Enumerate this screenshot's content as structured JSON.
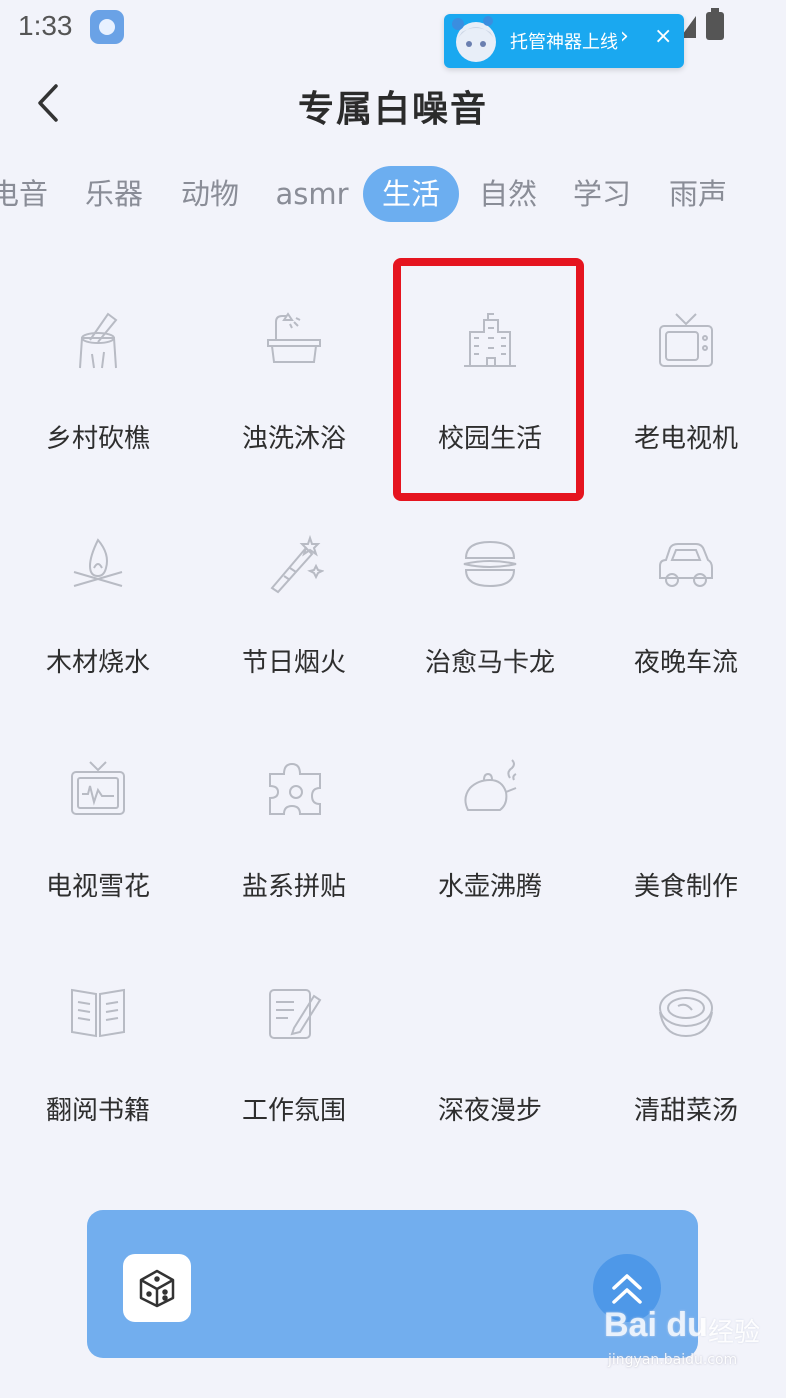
{
  "status_bar": {
    "time": "1:33"
  },
  "notification": {
    "text": "托管神器上线",
    "arrow": "›",
    "close": "×"
  },
  "header": {
    "title": "专属白噪音"
  },
  "tabs": [
    {
      "label": "电音"
    },
    {
      "label": "乐器"
    },
    {
      "label": "动物"
    },
    {
      "label": "asmr"
    },
    {
      "label": "生活",
      "active": true
    },
    {
      "label": "自然"
    },
    {
      "label": "学习"
    },
    {
      "label": "雨声"
    }
  ],
  "sounds": [
    {
      "label": "乡村砍樵",
      "icon": "axe-stump-icon"
    },
    {
      "label": "浊洗沐浴",
      "icon": "bathtub-shower-icon"
    },
    {
      "label": "校园生活",
      "icon": "school-building-icon"
    },
    {
      "label": "老电视机",
      "icon": "old-tv-icon"
    },
    {
      "label": "木材烧水",
      "icon": "campfire-icon"
    },
    {
      "label": "节日烟火",
      "icon": "firework-icon"
    },
    {
      "label": "治愈马卡龙",
      "icon": "macaron-icon"
    },
    {
      "label": "夜晚车流",
      "icon": "car-icon"
    },
    {
      "label": "电视雪花",
      "icon": "tv-static-icon"
    },
    {
      "label": "盐系拼贴",
      "icon": "puzzle-piece-icon"
    },
    {
      "label": "水壶沸腾",
      "icon": "teapot-icon"
    },
    {
      "label": "美食制作",
      "icon": "blank-icon"
    },
    {
      "label": "翻阅书籍",
      "icon": "open-book-icon"
    },
    {
      "label": "工作氛围",
      "icon": "notepad-pen-icon"
    },
    {
      "label": "深夜漫步",
      "icon": "blank-icon"
    },
    {
      "label": "清甜菜汤",
      "icon": "soup-bowl-icon"
    }
  ],
  "colors": {
    "accent": "#6caef0",
    "highlight": "#e5141f",
    "panel": "#72aeee",
    "icon_stroke": "#b8bbc4"
  },
  "watermark": {
    "logo": "Bai du",
    "jy": "经验",
    "url": "jingyan.baidu.com"
  }
}
